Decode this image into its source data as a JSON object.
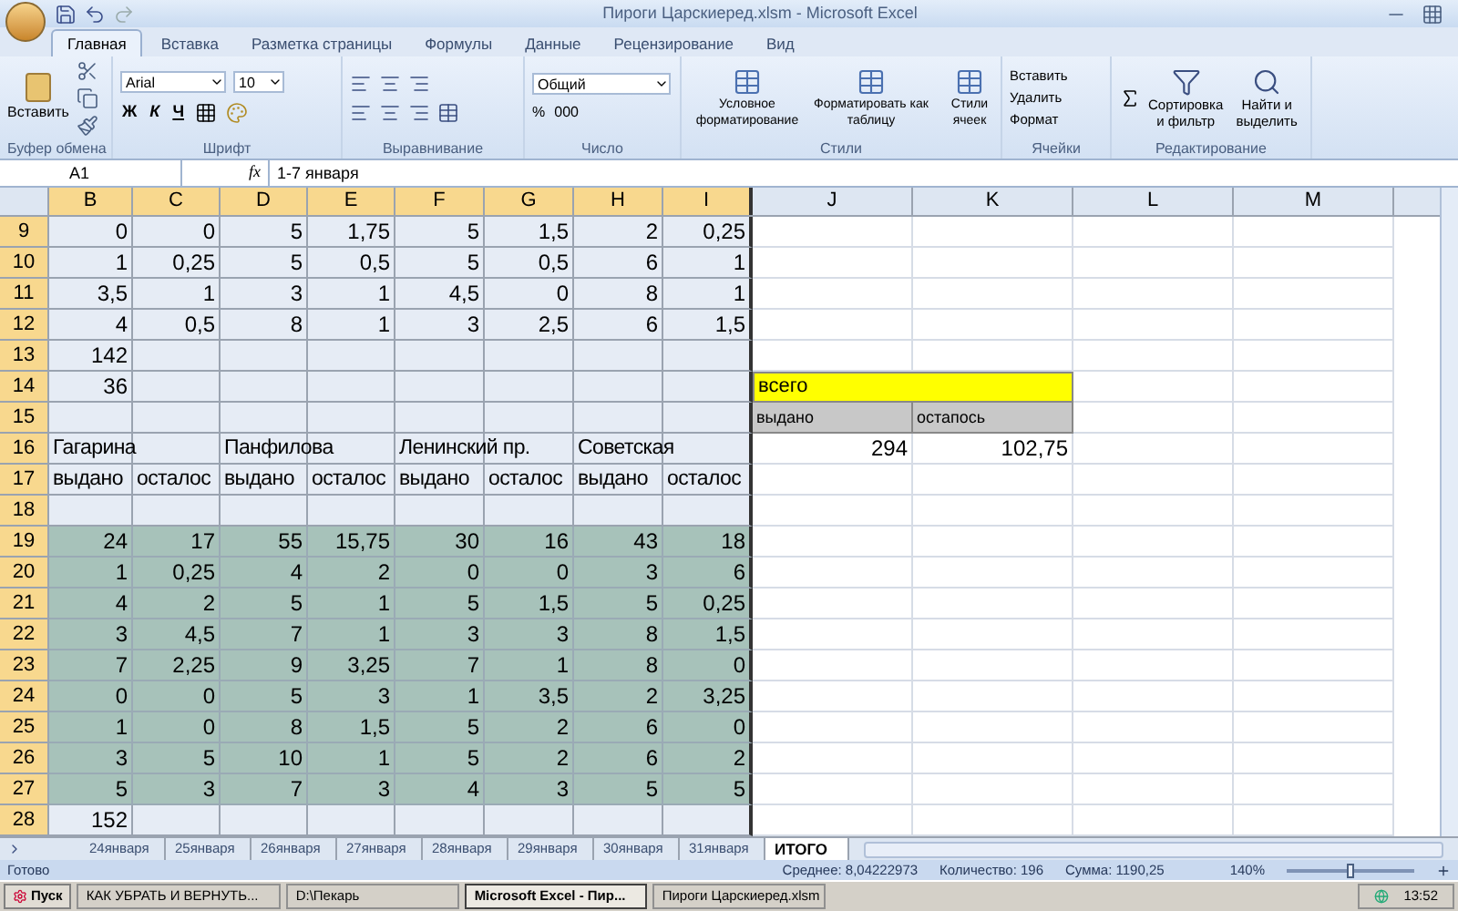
{
  "window": {
    "title": "Пироги Царскиеред.xlsm - Microsoft Excel"
  },
  "ribbon_tabs": [
    {
      "label": "Главная",
      "selected": true
    },
    {
      "label": "Вставка",
      "selected": false
    },
    {
      "label": "Разметка страницы",
      "selected": false
    },
    {
      "label": "Формулы",
      "selected": false
    },
    {
      "label": "Данные",
      "selected": false
    },
    {
      "label": "Рецензирование",
      "selected": false
    },
    {
      "label": "Вид",
      "selected": false
    }
  ],
  "ribbon": {
    "clipboard": {
      "paste": "Вставить",
      "label": "Буфер обмена"
    },
    "font": {
      "name": "Arial",
      "size": "10",
      "styles": [
        "Ж",
        "К",
        "Ч"
      ],
      "label": "Шрифт"
    },
    "alignment": {
      "label": "Выравнивание"
    },
    "number": {
      "format": "Общий",
      "percent": "%",
      "thousands": "000",
      "label": "Число"
    },
    "styles": {
      "buttons": [
        "Условное форматирование",
        "Форматировать как таблицу",
        "Стили ячеек"
      ],
      "label": "Стили"
    },
    "cells": {
      "buttons": [
        "Вставить",
        "Удалить",
        "Формат"
      ],
      "label": "Ячейки"
    },
    "editing": {
      "buttons": [
        "Сортировка и фильтр",
        "Найти и выделить"
      ],
      "label": "Редактирование"
    }
  },
  "formula_bar": {
    "name_box": "A1",
    "function_label": "fx",
    "value": "1-7 января"
  },
  "columns": [
    {
      "label": "B",
      "selected": true
    },
    {
      "label": "C",
      "selected": true
    },
    {
      "label": "D",
      "selected": true
    },
    {
      "label": "E",
      "selected": true
    },
    {
      "label": "F",
      "selected": true
    },
    {
      "label": "G",
      "selected": true
    },
    {
      "label": "H",
      "selected": true
    },
    {
      "label": "I",
      "selected": true
    },
    {
      "label": "J",
      "selected": false
    },
    {
      "label": "K",
      "selected": false
    },
    {
      "label": "L",
      "selected": false
    },
    {
      "label": "M",
      "selected": false
    }
  ],
  "rows": [
    {
      "number": "9",
      "selected": true,
      "shaded": false,
      "cells": [
        "0",
        "0",
        "5",
        "1,75",
        "5",
        "1,5",
        "2",
        "0,25"
      ]
    },
    {
      "number": "10",
      "selected": true,
      "shaded": false,
      "cells": [
        "1",
        "0,25",
        "5",
        "0,5",
        "5",
        "0,5",
        "6",
        "1"
      ]
    },
    {
      "number": "11",
      "selected": true,
      "shaded": false,
      "cells": [
        "3,5",
        "1",
        "3",
        "1",
        "4,5",
        "0",
        "8",
        "1"
      ]
    },
    {
      "number": "12",
      "selected": true,
      "shaded": false,
      "cells": [
        "4",
        "0,5",
        "8",
        "1",
        "3",
        "2,5",
        "6",
        "1,5"
      ]
    },
    {
      "number": "13",
      "selected": true,
      "shaded": false,
      "cells": [
        "142"
      ]
    },
    {
      "number": "14",
      "selected": true,
      "shaded": false,
      "cells": [
        "36",
        null,
        null,
        null,
        null,
        null,
        null,
        null,
        {
          "text": "всего",
          "kind": "banner"
        },
        null
      ]
    },
    {
      "number": "15",
      "selected": true,
      "shaded": false,
      "cells": [
        null,
        null,
        null,
        null,
        null,
        null,
        null,
        null,
        {
          "text": "выдано",
          "kind": "tag"
        },
        {
          "text": "остапось",
          "kind": "tag"
        }
      ]
    },
    {
      "number": "16",
      "selected": true,
      "shaded": false,
      "cells": [
        {
          "text": "Гагарина",
          "kind": "label"
        },
        null,
        {
          "text": "Панфилова",
          "kind": "label"
        },
        null,
        {
          "text": "Ленинский пр.",
          "kind": "label"
        },
        null,
        {
          "text": "Советская",
          "kind": "label"
        },
        null,
        "294",
        "102,75"
      ]
    },
    {
      "number": "17",
      "selected": true,
      "shaded": false,
      "cells": [
        {
          "text": "выдано",
          "kind": "label"
        },
        {
          "text": "осталос",
          "kind": "label"
        },
        {
          "text": "выдано",
          "kind": "label"
        },
        {
          "text": "осталос",
          "kind": "label"
        },
        {
          "text": "выдано",
          "kind": "label"
        },
        {
          "text": "осталос",
          "kind": "label"
        },
        {
          "text": "выдано",
          "kind": "label"
        },
        {
          "text": "осталос",
          "kind": "label"
        }
      ]
    },
    {
      "number": "18",
      "selected": true,
      "shaded": false,
      "cells": []
    },
    {
      "number": "19",
      "selected": true,
      "shaded": true,
      "cells": [
        "24",
        "17",
        "55",
        "15,75",
        "30",
        "16",
        "43",
        "18"
      ]
    },
    {
      "number": "20",
      "selected": true,
      "shaded": true,
      "cells": [
        "1",
        "0,25",
        "4",
        "2",
        "0",
        "0",
        "3",
        "6"
      ]
    },
    {
      "number": "21",
      "selected": true,
      "shaded": true,
      "cells": [
        "4",
        "2",
        "5",
        "1",
        "5",
        "1,5",
        "5",
        "0,25"
      ]
    },
    {
      "number": "22",
      "selected": true,
      "shaded": true,
      "cells": [
        "3",
        "4,5",
        "7",
        "1",
        "3",
        "3",
        "8",
        "1,5"
      ]
    },
    {
      "number": "23",
      "selected": true,
      "shaded": true,
      "cells": [
        "7",
        "2,25",
        "9",
        "3,25",
        "7",
        "1",
        "8",
        "0"
      ]
    },
    {
      "number": "24",
      "selected": true,
      "shaded": true,
      "cells": [
        "0",
        "0",
        "5",
        "3",
        "1",
        "3,5",
        "2",
        "3,25"
      ]
    },
    {
      "number": "25",
      "selected": true,
      "shaded": true,
      "cells": [
        "1",
        "0",
        "8",
        "1,5",
        "5",
        "2",
        "6",
        "0"
      ]
    },
    {
      "number": "26",
      "selected": true,
      "shaded": true,
      "cells": [
        "3",
        "5",
        "10",
        "1",
        "5",
        "2",
        "6",
        "2"
      ]
    },
    {
      "number": "27",
      "selected": true,
      "shaded": true,
      "cells": [
        "5",
        "3",
        "7",
        "3",
        "4",
        "3",
        "5",
        "5"
      ]
    },
    {
      "number": "28",
      "selected": true,
      "shaded": false,
      "cells": [
        "152"
      ]
    }
  ],
  "sheet_tabs": [
    {
      "label": "24января",
      "selected": false
    },
    {
      "label": "25января",
      "selected": false
    },
    {
      "label": "26января",
      "selected": false
    },
    {
      "label": "27января",
      "selected": false
    },
    {
      "label": "28января",
      "selected": false
    },
    {
      "label": "29января",
      "selected": false
    },
    {
      "label": "30января",
      "selected": false
    },
    {
      "label": "31января",
      "selected": false
    },
    {
      "label": "ИТОГО",
      "selected": true
    }
  ],
  "status_bar": {
    "state": "Готово",
    "average": "Среднее: 8,04222973",
    "count": "Количество: 196",
    "sum": "Сумма: 1190,25",
    "zoom": "140%",
    "zoom_slider": {
      "level": 0.5
    }
  },
  "taskbar": {
    "start": "Пуск",
    "windows": [
      {
        "label": "КАК УБРАТЬ И ВЕРНУТЬ...",
        "selected": false
      },
      {
        "label": "D:\\Пекарь",
        "selected": false
      },
      {
        "label": "Microsoft Excel - Пир...",
        "selected": true
      },
      {
        "label": "Пироги Царскиеред.xlsm",
        "selected": false
      }
    ],
    "clock": "13:52"
  }
}
